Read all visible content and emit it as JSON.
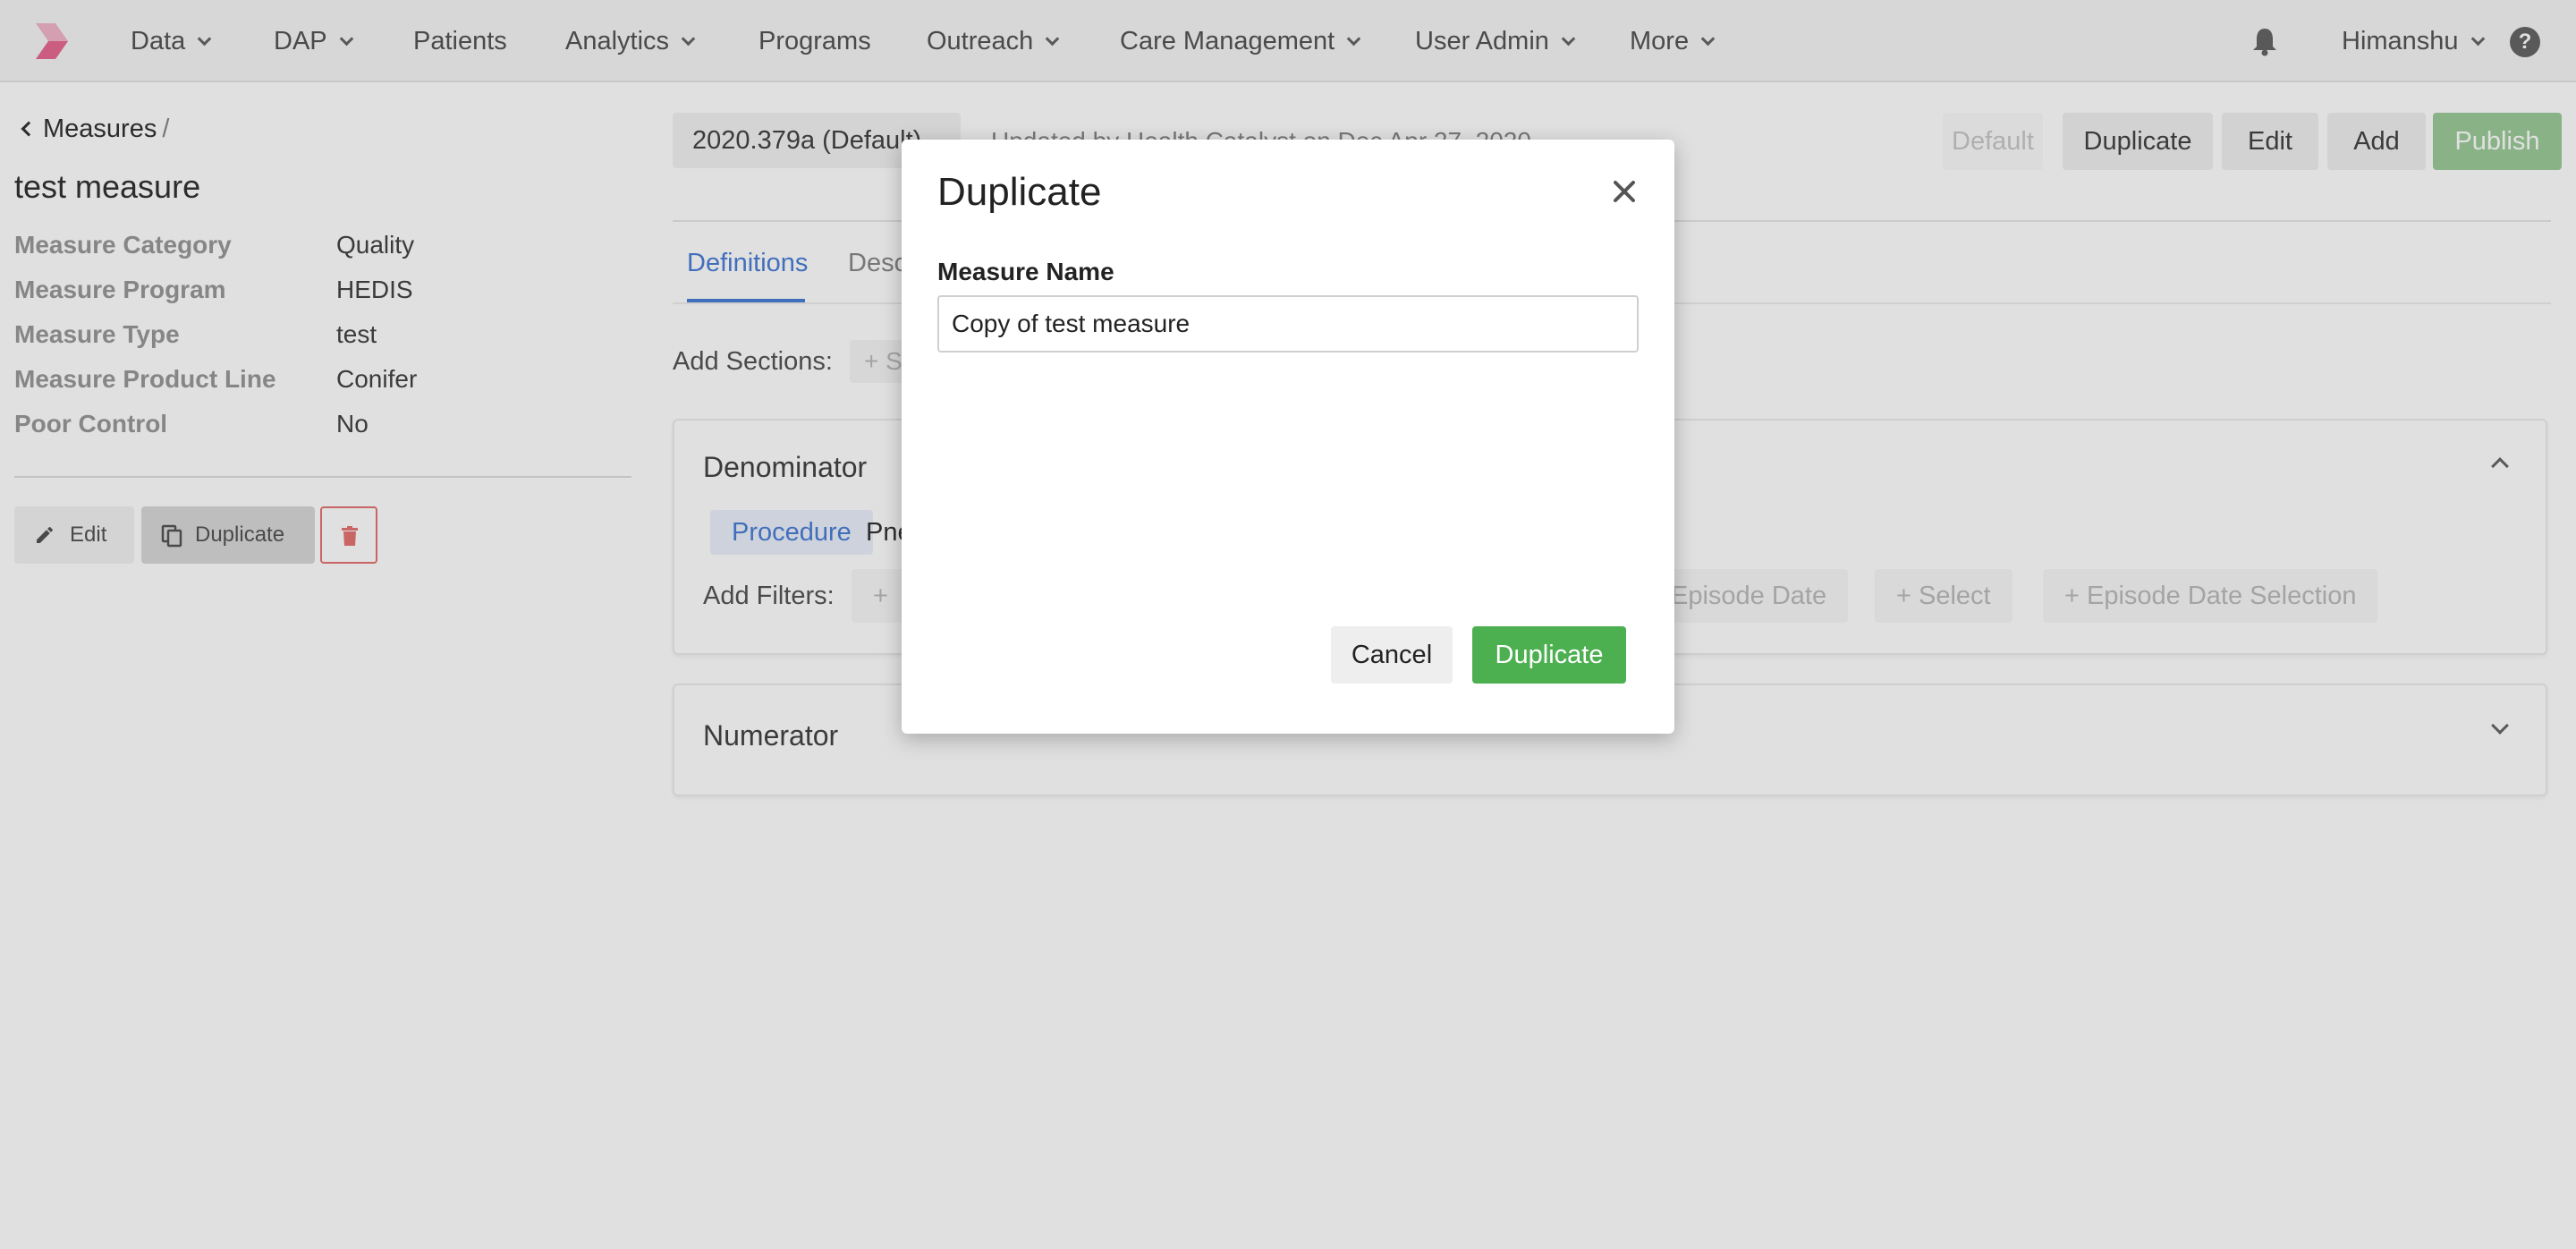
{
  "nav": {
    "items": [
      {
        "label": "Data",
        "dropdown": true
      },
      {
        "label": "DAP",
        "dropdown": true
      },
      {
        "label": "Patients",
        "dropdown": false
      },
      {
        "label": "Analytics",
        "dropdown": true
      },
      {
        "label": "Programs",
        "dropdown": false
      },
      {
        "label": "Outreach",
        "dropdown": true
      },
      {
        "label": "Care Management",
        "dropdown": true
      },
      {
        "label": "User Admin",
        "dropdown": true
      },
      {
        "label": "More",
        "dropdown": true
      }
    ],
    "user": "Himanshu",
    "help_icon": "?"
  },
  "breadcrumb": {
    "parent": "Measures",
    "separator": "/"
  },
  "measure": {
    "title": "test measure",
    "properties": [
      {
        "label": "Measure Category",
        "value": "Quality"
      },
      {
        "label": "Measure Program",
        "value": "HEDIS"
      },
      {
        "label": "Measure Type",
        "value": "test"
      },
      {
        "label": "Measure Product Line",
        "value": "Conifer"
      },
      {
        "label": "Poor Control",
        "value": "No"
      }
    ],
    "actions": {
      "edit": "Edit",
      "duplicate": "Duplicate"
    }
  },
  "version": {
    "selected": "2020.379a (Default)",
    "updated_text": "Updated by Health Catalyst on Dec Apr 27, 2020"
  },
  "toolbar": {
    "default": "Default",
    "duplicate": "Duplicate",
    "edit": "Edit",
    "add": "Add",
    "publish": "Publish"
  },
  "tabs": [
    {
      "label": "Definitions",
      "active": true
    },
    {
      "label": "Desc",
      "active": false
    }
  ],
  "add_sections_label": "Add Sections:",
  "add_sections_btn": "+ S",
  "cards": {
    "denominator": {
      "title": "Denominator",
      "chip_label": "Procedure",
      "chip_value": "Pne",
      "add_filters_label": "Add Filters:",
      "filter_btn_partial": "+",
      "filters": [
        "Episode Date",
        "+ Select",
        "+ Episode Date Selection"
      ]
    },
    "numerator": {
      "title": "Numerator"
    }
  },
  "modal": {
    "title": "Duplicate",
    "field_label": "Measure Name",
    "field_value": "Copy of test measure",
    "cancel": "Cancel",
    "confirm": "Duplicate"
  },
  "colors": {
    "accent_blue": "#4a7fd6",
    "green": "#4caf50",
    "publish_green": "#9ccc9a",
    "delete_red": "#e57373",
    "logo_pink": "#e91e63"
  }
}
